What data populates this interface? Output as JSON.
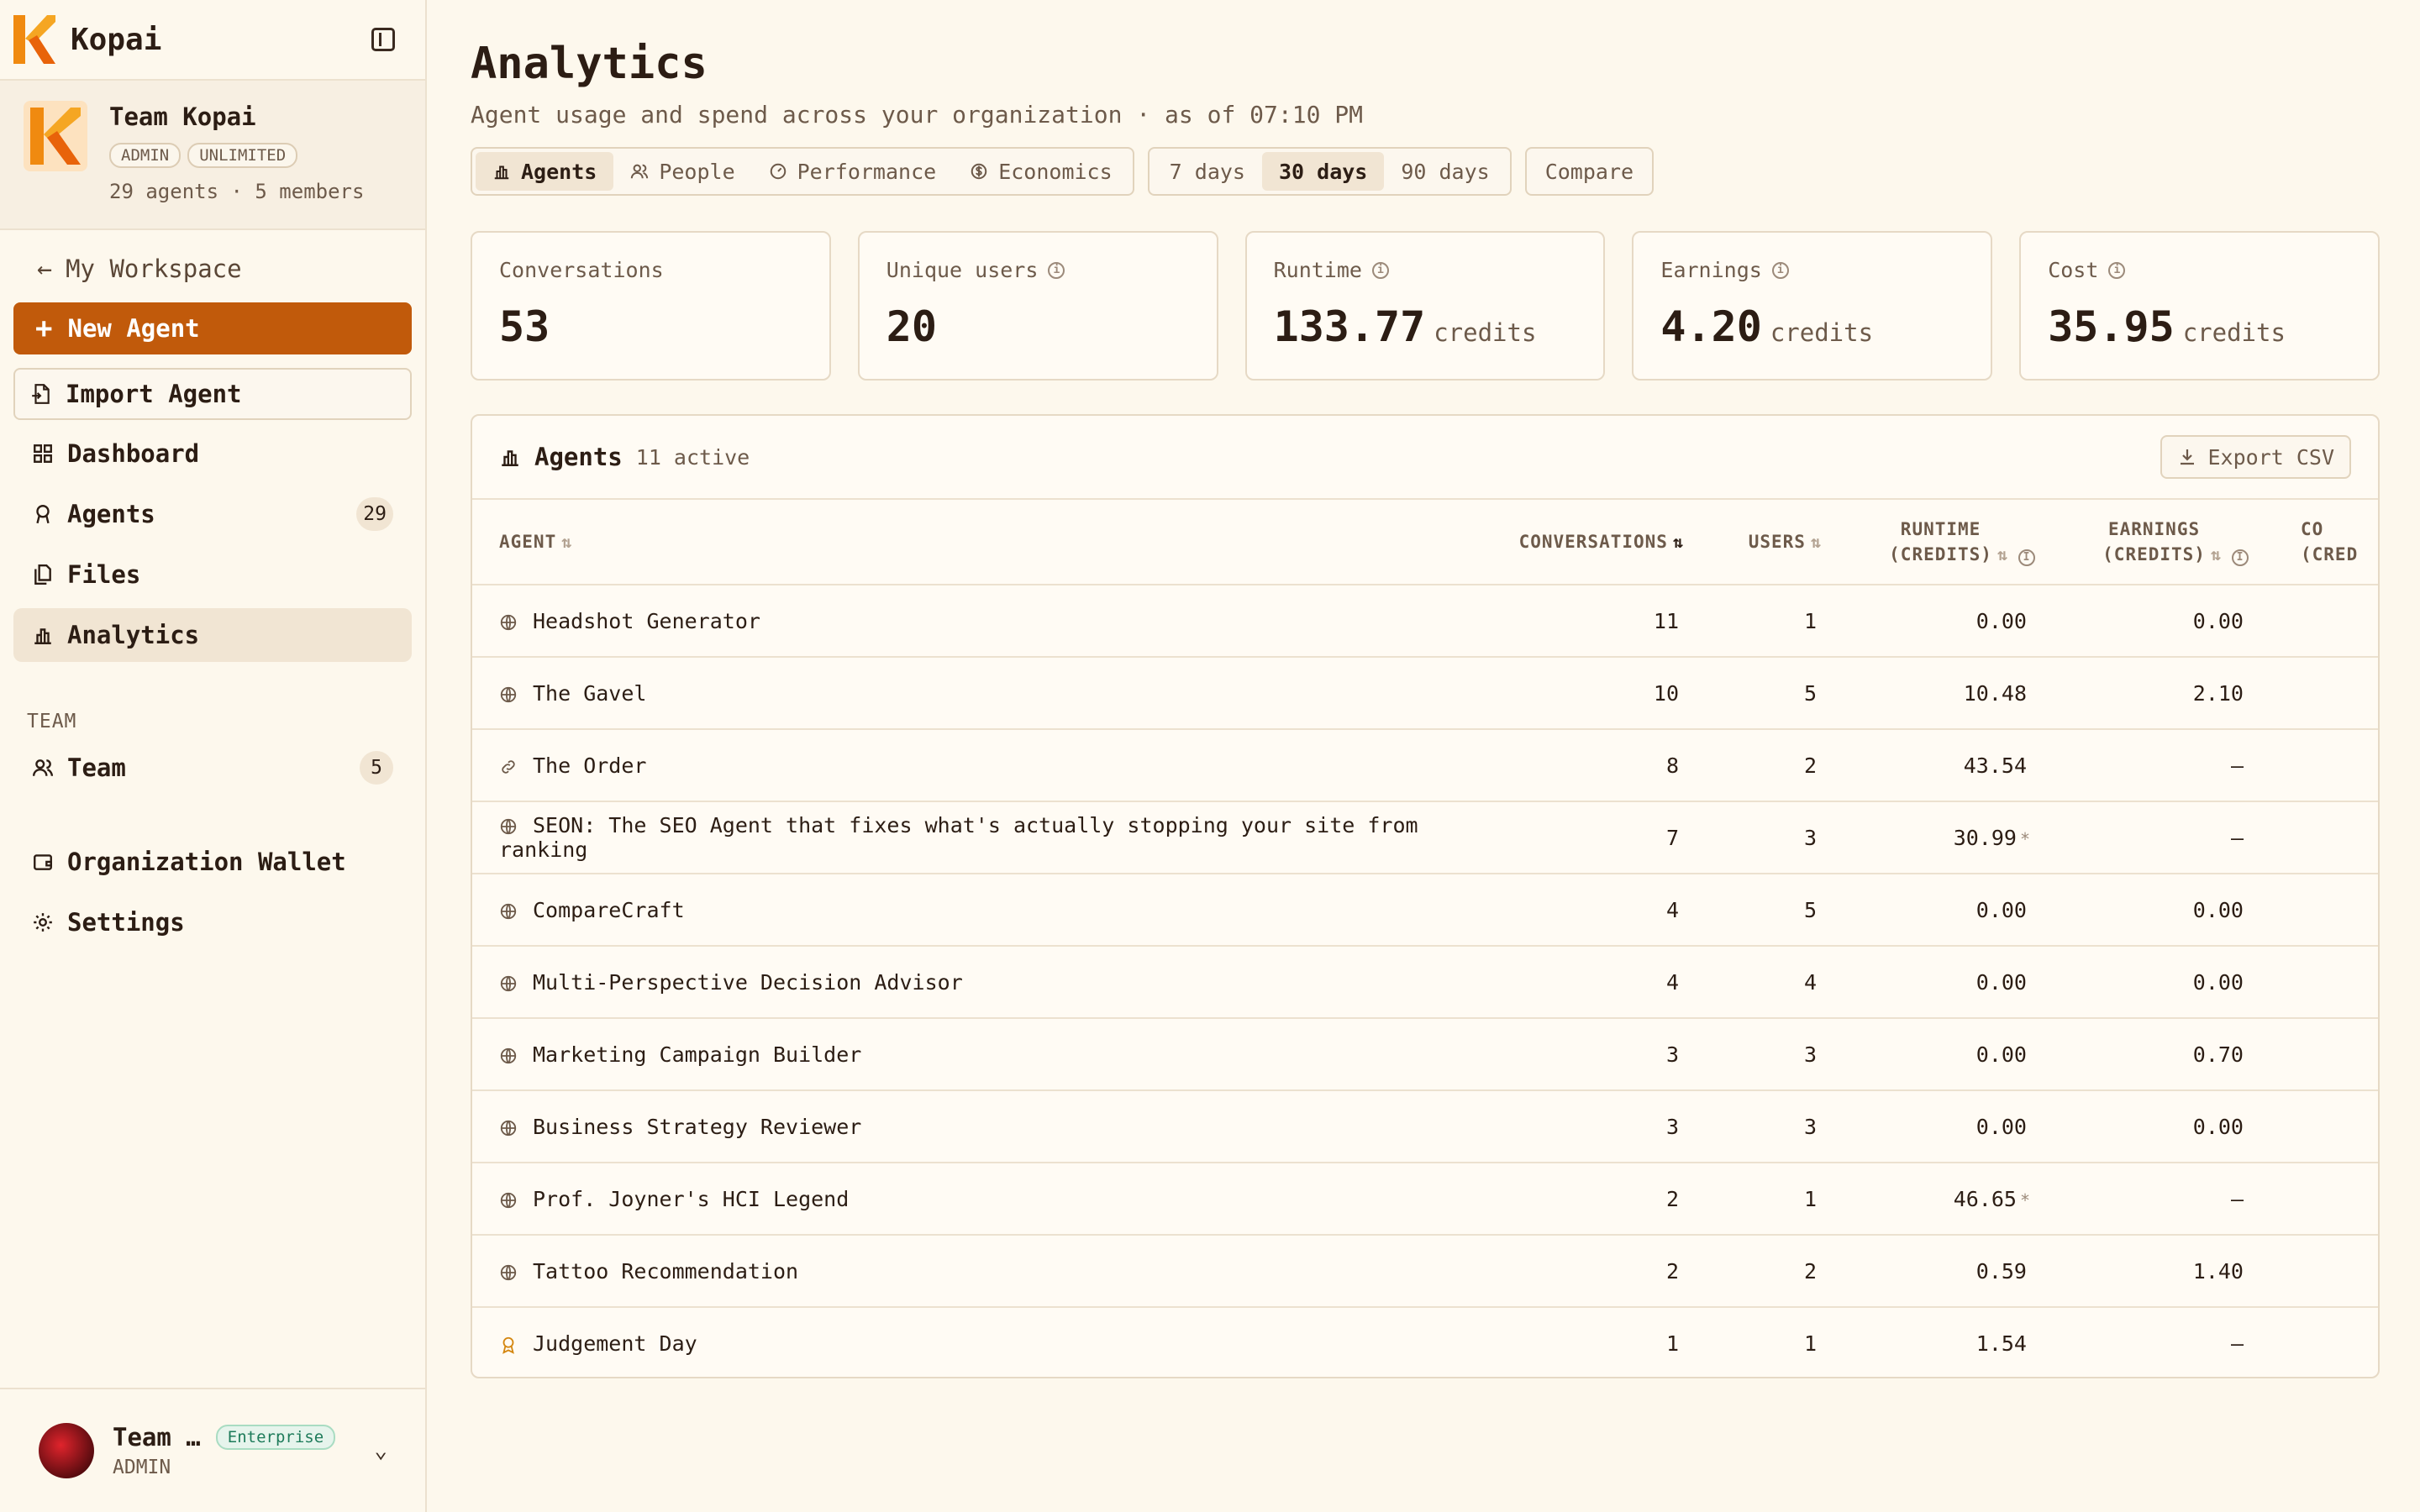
{
  "app": {
    "name": "Kopai"
  },
  "team": {
    "name": "Team Kopai",
    "badges": [
      "ADMIN",
      "UNLIMITED"
    ],
    "meta": "29 agents · 5 members"
  },
  "nav": {
    "back": "My Workspace",
    "new_agent": "New Agent",
    "import_agent": "Import Agent",
    "items": [
      {
        "label": "Dashboard"
      },
      {
        "label": "Agents",
        "count": "29"
      },
      {
        "label": "Files"
      },
      {
        "label": "Analytics"
      }
    ],
    "team_section": "TEAM",
    "team_item": {
      "label": "Team",
      "count": "5"
    },
    "wallet": "Organization Wallet",
    "settings": "Settings"
  },
  "user": {
    "name": "Team …",
    "plan": "Enterprise",
    "role": "ADMIN"
  },
  "page": {
    "title": "Analytics",
    "subtitle": "Agent usage and spend across your organization · as of 07:10 PM"
  },
  "tabs": [
    "Agents",
    "People",
    "Performance",
    "Economics"
  ],
  "ranges": [
    "7 days",
    "30 days",
    "90 days"
  ],
  "compare": "Compare",
  "stats": [
    {
      "label": "Conversations",
      "value": "53",
      "unit": ""
    },
    {
      "label": "Unique users",
      "value": "20",
      "unit": ""
    },
    {
      "label": "Runtime",
      "value": "133.77",
      "unit": "credits"
    },
    {
      "label": "Earnings",
      "value": "4.20",
      "unit": "credits"
    },
    {
      "label": "Cost",
      "value": "35.95",
      "unit": "credits"
    }
  ],
  "table": {
    "title": "Agents",
    "subtitle": "11 active",
    "export": "Export CSV",
    "columns": {
      "agent": "AGENT",
      "conversations": "CONVERSATIONS",
      "users": "USERS",
      "runtime_1": "RUNTIME",
      "runtime_2": "(CREDITS)",
      "earnings_1": "EARNINGS",
      "earnings_2": "(CREDITS)",
      "cost_1": "CO",
      "cost_2": "(CRED"
    },
    "rows": [
      {
        "icon": "globe-icon",
        "name": "Headshot Generator",
        "conversations": "11",
        "users": "1",
        "runtime": "0.00",
        "runtime_star": "",
        "earnings": "0.00"
      },
      {
        "icon": "globe-icon",
        "name": "The Gavel",
        "conversations": "10",
        "users": "5",
        "runtime": "10.48",
        "runtime_star": "",
        "earnings": "2.10"
      },
      {
        "icon": "link-icon",
        "name": "The Order",
        "conversations": "8",
        "users": "2",
        "runtime": "43.54",
        "runtime_star": "",
        "earnings": "—"
      },
      {
        "icon": "globe-icon",
        "name": "SEON: The SEO Agent that fixes what's actually stopping your site from ranking",
        "conversations": "7",
        "users": "3",
        "runtime": "30.99",
        "runtime_star": "*",
        "earnings": "—"
      },
      {
        "icon": "globe-icon",
        "name": "CompareCraft",
        "conversations": "4",
        "users": "5",
        "runtime": "0.00",
        "runtime_star": "",
        "earnings": "0.00"
      },
      {
        "icon": "globe-icon",
        "name": "Multi-Perspective Decision Advisor",
        "conversations": "4",
        "users": "4",
        "runtime": "0.00",
        "runtime_star": "",
        "earnings": "0.00"
      },
      {
        "icon": "globe-icon",
        "name": "Marketing Campaign Builder",
        "conversations": "3",
        "users": "3",
        "runtime": "0.00",
        "runtime_star": "",
        "earnings": "0.70"
      },
      {
        "icon": "globe-icon",
        "name": "Business Strategy Reviewer",
        "conversations": "3",
        "users": "3",
        "runtime": "0.00",
        "runtime_star": "",
        "earnings": "0.00"
      },
      {
        "icon": "globe-icon",
        "name": "Prof. Joyner's HCI Legend",
        "conversations": "2",
        "users": "1",
        "runtime": "46.65",
        "runtime_star": "*",
        "earnings": "—"
      },
      {
        "icon": "globe-icon",
        "name": "Tattoo Recommendation",
        "conversations": "2",
        "users": "2",
        "runtime": "0.59",
        "runtime_star": "",
        "earnings": "1.40"
      },
      {
        "icon": "badge-icon",
        "name": "Judgement Day",
        "conversations": "1",
        "users": "1",
        "runtime": "1.54",
        "runtime_star": "",
        "earnings": "—"
      }
    ]
  },
  "colors": {
    "accent": "#c15a0b",
    "background": "#fdf8ed",
    "card": "#fffbf4",
    "border": "#e6d9c5",
    "active_bg": "#f1e5d3"
  }
}
